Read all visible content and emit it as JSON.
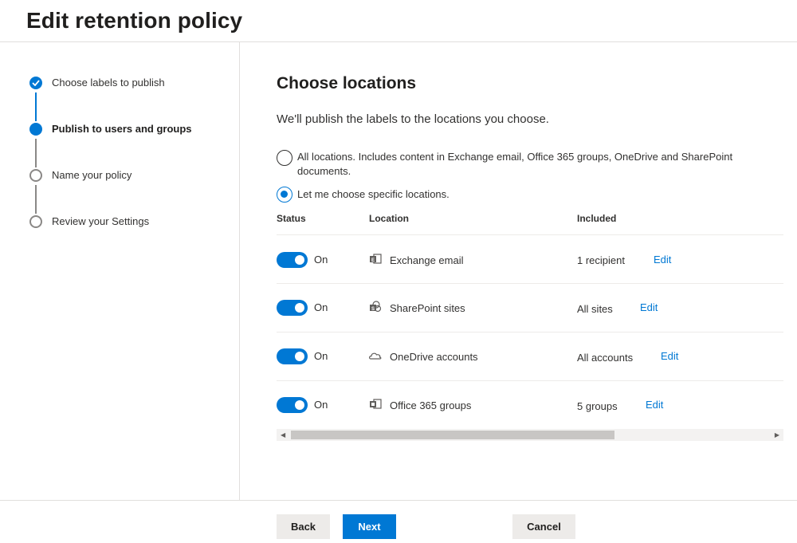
{
  "page": {
    "title": "Edit retention policy"
  },
  "steps": [
    {
      "label": "Choose labels to publish",
      "state": "done"
    },
    {
      "label": "Publish to users and groups",
      "state": "current"
    },
    {
      "label": "Name your policy",
      "state": "todo"
    },
    {
      "label": "Review your Settings",
      "state": "todo"
    }
  ],
  "main": {
    "title": "Choose locations",
    "description": "We'll publish the labels to the locations you choose.",
    "options": [
      {
        "line1": "All locations. Includes content in Exchange email, Office 365 groups, OneDrive and SharePoint",
        "line2": "documents.",
        "selected": false
      },
      {
        "line1": "Let me choose specific locations.",
        "selected": true
      }
    ],
    "table": {
      "columns": {
        "status": "Status",
        "location": "Location",
        "included": "Included"
      },
      "rows": [
        {
          "status": "On",
          "icon": "exchange-icon",
          "location": "Exchange email",
          "included": "1 recipient",
          "edit": "Edit"
        },
        {
          "status": "On",
          "icon": "sharepoint-icon",
          "location": "SharePoint sites",
          "included": "All sites",
          "edit": "Edit"
        },
        {
          "status": "On",
          "icon": "onedrive-icon",
          "location": "OneDrive accounts",
          "included": "All accounts",
          "edit": "Edit"
        },
        {
          "status": "On",
          "icon": "office365-groups-icon",
          "location": "Office 365 groups",
          "included": "5 groups",
          "edit": "Edit"
        }
      ]
    }
  },
  "footer": {
    "back": "Back",
    "next": "Next",
    "cancel": "Cancel"
  },
  "colors": {
    "accent": "#0078d4",
    "text": "#323130",
    "border": "#e1dfdd"
  }
}
